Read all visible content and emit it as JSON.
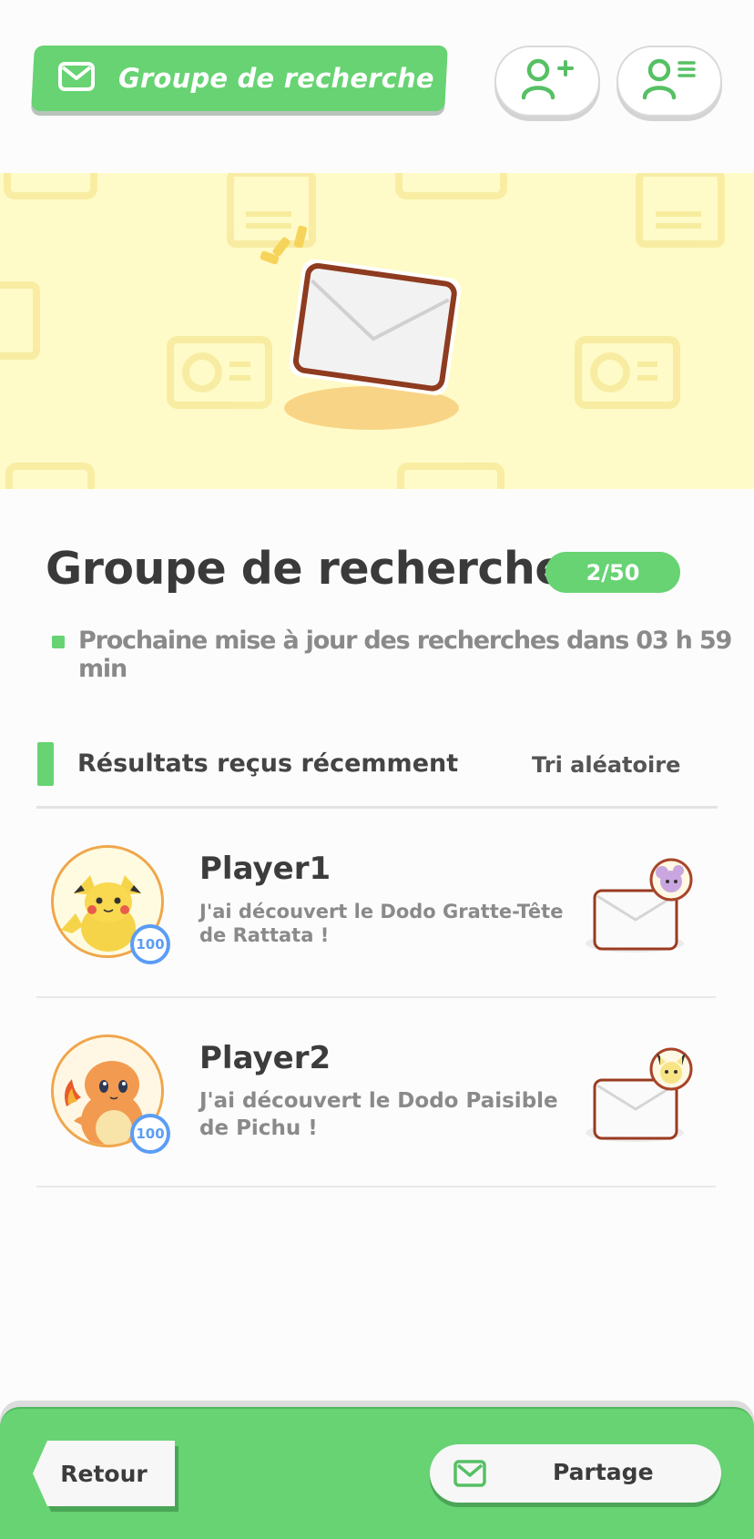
{
  "header": {
    "title": "Groupe de recherche",
    "add_friend_icon": "person-plus-icon",
    "friend_list_icon": "person-list-icon"
  },
  "section": {
    "title": "Groupe de recherche",
    "count": "2/50",
    "update_text": "Prochaine mise à jour des recherches dans 03 h 59 min"
  },
  "results": {
    "title": "Résultats reçus récemment",
    "sort_label": "Tri aléatoire",
    "items": [
      {
        "player": "Player1",
        "level": "100",
        "message": "J'ai découvert le Dodo Gratte-Tête de Rattata !",
        "avatar": "pikachu-avatar",
        "envelope_pokemon": "rattata-icon"
      },
      {
        "player": "Player2",
        "level": "100",
        "message": "J'ai découvert le Dodo Paisible de Pichu !",
        "avatar": "charmander-avatar",
        "envelope_pokemon": "pichu-icon"
      }
    ]
  },
  "footer": {
    "back_label": "Retour",
    "share_label": "Partage"
  },
  "colors": {
    "accent": "#67d373",
    "banner": "#fffbc8",
    "level_badge": "#5b9df5",
    "text_dark": "#3a3a3a",
    "text_muted": "#8a8a8a"
  }
}
